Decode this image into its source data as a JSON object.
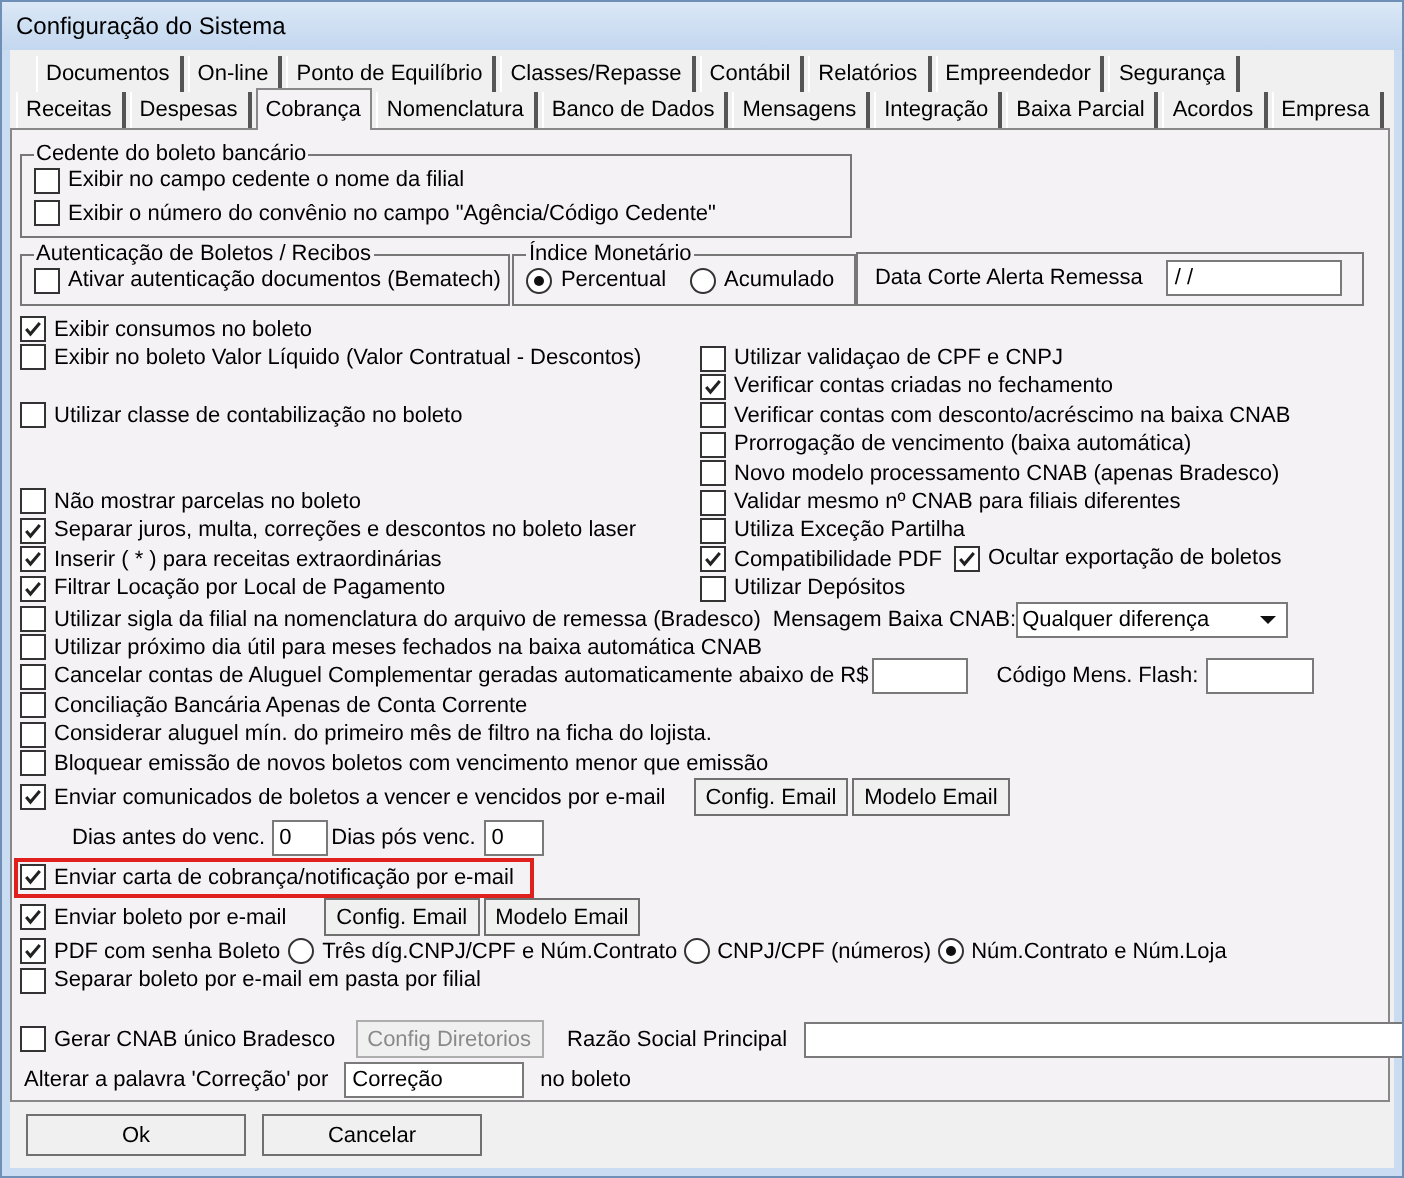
{
  "window": {
    "title": "Configuração do Sistema"
  },
  "tab_rows": [
    [
      {
        "label": "Documentos",
        "selected": false
      },
      {
        "label": "On-line",
        "selected": false
      },
      {
        "label": "Ponto de Equilíbrio",
        "selected": false
      },
      {
        "label": "Classes/Repasse",
        "selected": false
      },
      {
        "label": "Contábil",
        "selected": false
      },
      {
        "label": "Relatórios",
        "selected": false
      },
      {
        "label": "Empreendedor",
        "selected": false
      },
      {
        "label": "Segurança",
        "selected": false
      }
    ],
    [
      {
        "label": "Receitas",
        "selected": false
      },
      {
        "label": "Despesas",
        "selected": false
      },
      {
        "label": "Cobrança",
        "selected": true
      },
      {
        "label": "Nomenclatura",
        "selected": false
      },
      {
        "label": "Banco de Dados",
        "selected": false
      },
      {
        "label": "Mensagens",
        "selected": false
      },
      {
        "label": "Integração",
        "selected": false
      },
      {
        "label": "Baixa Parcial",
        "selected": false
      },
      {
        "label": "Acordos",
        "selected": false
      },
      {
        "label": "Empresa",
        "selected": false
      }
    ]
  ],
  "cedente": {
    "title": "Cedente do boleto bancário",
    "options": [
      {
        "label": "Exibir no campo cedente o nome da filial",
        "checked": false
      },
      {
        "label": "Exibir o número do convênio no campo \"Agência/Código Cedente\"",
        "checked": false
      }
    ]
  },
  "autenticacao": {
    "title": "Autenticação de Boletos / Recibos",
    "options": [
      {
        "label": "Ativar autenticação documentos (Bematech)",
        "checked": false
      }
    ]
  },
  "indice": {
    "title": "Índice Monetário",
    "options": [
      {
        "label": "Percentual",
        "selected": true
      },
      {
        "label": "Acumulado",
        "selected": false
      }
    ]
  },
  "data_corte": {
    "label": "Data Corte Alerta Remessa",
    "value": "/ /"
  },
  "left_options": [
    {
      "label": "Exibir consumos no boleto",
      "checked": true
    },
    {
      "label": "Exibir no boleto Valor Líquido (Valor Contratual - Descontos)",
      "checked": false
    },
    {
      "label": "Utilizar classe de contabilização no boleto",
      "checked": false
    },
    {
      "label": "Não mostrar parcelas no boleto",
      "checked": false
    },
    {
      "label": "Separar juros, multa, correções e descontos no boleto laser",
      "checked": true
    },
    {
      "label": "Inserir ( * ) para receitas extraordinárias",
      "checked": true
    },
    {
      "label": "Filtrar Locação por Local de Pagamento",
      "checked": true
    }
  ],
  "right_options": [
    {
      "label": "Utilizar validaçao de CPF e CNPJ",
      "checked": false
    },
    {
      "label": "Verificar contas criadas no fechamento",
      "checked": true
    },
    {
      "label": "Verificar contas com desconto/acréscimo na baixa CNAB",
      "checked": false
    },
    {
      "label": "Prorrogação de vencimento (baixa automática)",
      "checked": false
    },
    {
      "label": "Novo modelo processamento CNAB (apenas Bradesco)",
      "checked": false
    },
    {
      "label": "Validar mesmo nº CNAB para filiais diferentes",
      "checked": false
    },
    {
      "label": "Utiliza Exceção Partilha",
      "checked": false
    },
    {
      "label": "Compatibilidade PDF",
      "checked": true,
      "companion": {
        "label": "Ocultar exportação de boletos",
        "checked": true
      }
    },
    {
      "label": "Utilizar Depósitos",
      "checked": false
    }
  ],
  "rows": [
    [
      {
        "kind": "checkbox",
        "label": "Utilizar sigla da filial na nomenclatura do arquivo de remessa (Bradesco)",
        "checked": false
      },
      {
        "kind": "label",
        "label": "Mensagem Baixa CNAB:"
      },
      {
        "kind": "dropdown",
        "value": "Qualquer diferença"
      }
    ],
    [
      {
        "kind": "checkbox",
        "label": "Utilizar próximo dia útil para meses fechados na baixa automática CNAB",
        "checked": false
      }
    ],
    [
      {
        "kind": "checkbox",
        "label": "Cancelar contas de Aluguel Complementar geradas automaticamente abaixo de R$",
        "checked": false
      },
      {
        "kind": "field"
      },
      {
        "kind": "label",
        "label": "Código Mens. Flash:"
      },
      {
        "kind": "field"
      }
    ],
    [
      {
        "kind": "checkbox",
        "label": "Conciliação Bancária Apenas de Conta Corrente",
        "checked": false
      }
    ],
    [
      {
        "kind": "checkbox",
        "label": "Considerar aluguel mín. do primeiro mês de filtro na ficha do lojista.",
        "checked": false
      }
    ],
    [
      {
        "kind": "checkbox",
        "label": "Bloquear emissão de novos boletos com vencimento menor que emissão",
        "checked": false
      }
    ],
    [
      {
        "kind": "checkbox",
        "label": "Enviar comunicados de boletos a vencer e vencidos por e-mail",
        "checked": true
      },
      {
        "kind": "button",
        "label": "Config. Email",
        "disabled": false
      },
      {
        "kind": "button",
        "label": "Modelo Email",
        "disabled": false
      }
    ],
    [
      {
        "kind": "label",
        "label": "Dias antes do venc."
      },
      {
        "kind": "field",
        "value": "0"
      },
      {
        "kind": "label",
        "label": "Dias pós venc."
      },
      {
        "kind": "field",
        "value": "0"
      }
    ],
    [
      {
        "kind": "checkbox",
        "label": "Enviar carta de cobrança/notificação por e-mail",
        "checked": true,
        "highlighted": true
      }
    ],
    [
      {
        "kind": "checkbox",
        "label": "Enviar boleto por e-mail",
        "checked": true
      },
      {
        "kind": "button",
        "label": "Config. Email",
        "disabled": false
      },
      {
        "kind": "button",
        "label": "Modelo Email",
        "disabled": false
      }
    ],
    [
      {
        "kind": "checkbox",
        "label": "PDF com senha Boleto",
        "checked": true
      },
      {
        "kind": "radio",
        "label": "Três díg.CNPJ/CPF e Núm.Contrato",
        "selected": false
      },
      {
        "kind": "radio",
        "label": "CNPJ/CPF (números)",
        "selected": false
      },
      {
        "kind": "radio",
        "label": "Núm.Contrato e Núm.Loja",
        "selected": true
      }
    ],
    [
      {
        "kind": "checkbox",
        "label": "Separar boleto por e-mail em pasta por filial",
        "checked": false
      }
    ],
    [
      {
        "kind": "checkbox",
        "label": "Gerar CNAB único Bradesco",
        "checked": false
      },
      {
        "kind": "button",
        "label": "Config Diretorios",
        "disabled": true
      },
      {
        "kind": "label",
        "label": "Razão Social Principal"
      },
      {
        "kind": "field"
      }
    ],
    [
      {
        "kind": "label",
        "label": "Alterar a palavra 'Correção' por"
      },
      {
        "kind": "field",
        "value": "Correção"
      },
      {
        "kind": "label",
        "label": "no boleto"
      }
    ]
  ],
  "footer_buttons": [
    "Ok",
    "Cancelar"
  ]
}
